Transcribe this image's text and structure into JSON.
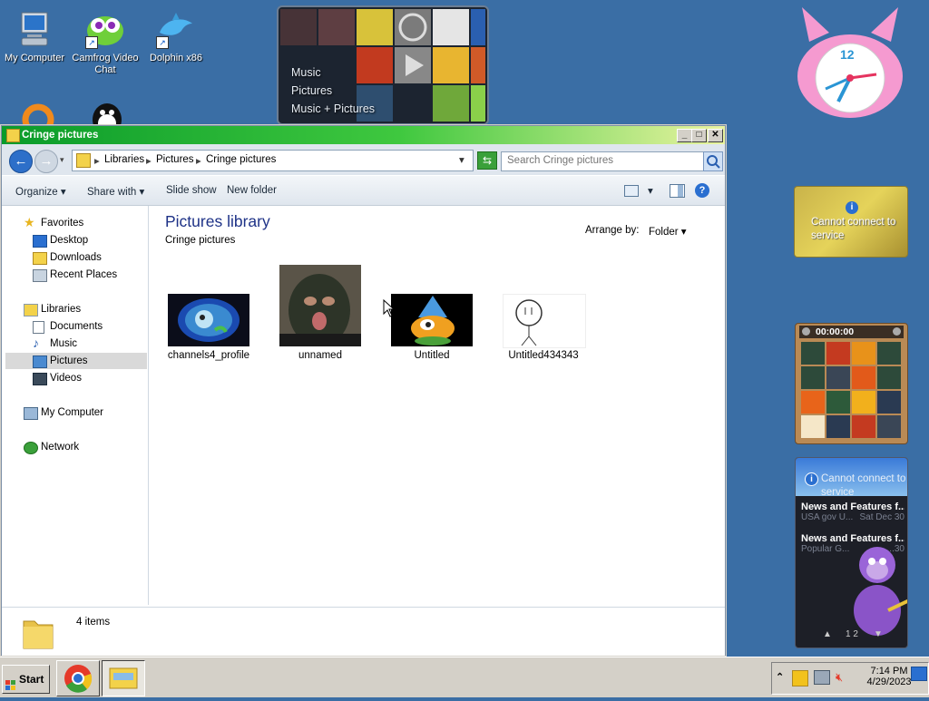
{
  "desktop": {
    "icons": [
      {
        "label": "My Computer"
      },
      {
        "label": "Camfrog Video Chat"
      },
      {
        "label": "Dolphin x86"
      }
    ]
  },
  "media_gadget": {
    "items": [
      "Music",
      "Pictures",
      "Music + Pictures"
    ]
  },
  "clock_gadget": {
    "label": "12"
  },
  "weather_gadget": {
    "message": "Cannot connect to service"
  },
  "puzzle_gadget": {
    "time": "00:00:00"
  },
  "news_gadget": {
    "message": "Cannot connect to service",
    "items": [
      {
        "title": "News and Features f...",
        "source": "USA gov U...",
        "date": "Sat Dec 30"
      },
      {
        "title": "News and Features f...",
        "source": "Popular G...",
        "date": "...30"
      }
    ],
    "pager": "1 2"
  },
  "window": {
    "title": "Cringe pictures",
    "breadcrumb": [
      "Libraries",
      "Pictures",
      "Cringe pictures"
    ],
    "search_placeholder": "Search Cringe pictures",
    "toolbar": {
      "organize": "Organize",
      "share_with": "Share with",
      "slide_show": "Slide show",
      "new_folder": "New folder"
    },
    "nav": {
      "favorites": "Favorites",
      "desktop": "Desktop",
      "downloads": "Downloads",
      "recent_places": "Recent Places",
      "libraries": "Libraries",
      "documents": "Documents",
      "music": "Music",
      "pictures": "Pictures",
      "videos": "Videos",
      "my_computer": "My Computer",
      "network": "Network"
    },
    "content": {
      "heading": "Pictures library",
      "subheading": "Cringe pictures",
      "arrange_by_label": "Arrange by:",
      "arrange_by_value": "Folder",
      "files": [
        "channels4_profile",
        "unnamed",
        "Untitled",
        "Untitled434343"
      ]
    },
    "status": {
      "items_count": "4 items"
    }
  },
  "taskbar": {
    "start": "Start",
    "time": "7:14 PM",
    "date": "4/29/2023"
  }
}
